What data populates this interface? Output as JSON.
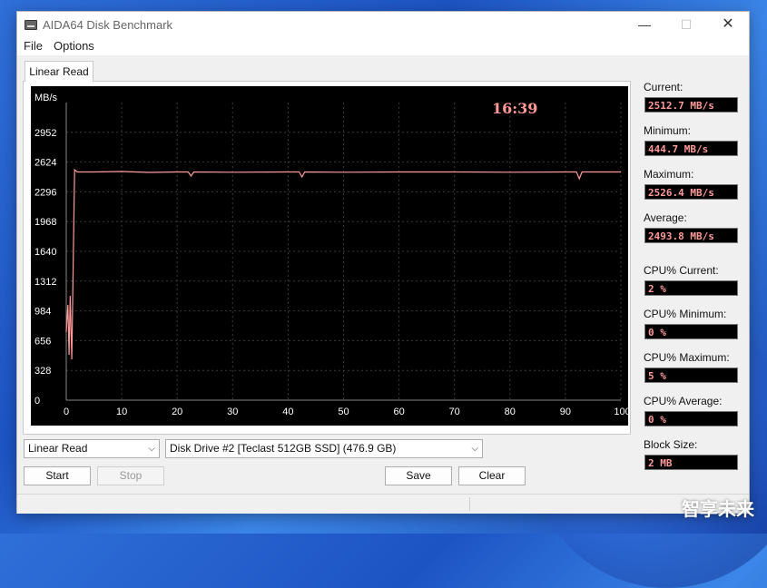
{
  "window": {
    "title": "AIDA64 Disk Benchmark",
    "controls": {
      "minimize": "—",
      "maximize": "☐",
      "close": "✕"
    }
  },
  "menu": {
    "file": "File",
    "options": "Options"
  },
  "tab": {
    "label": "Linear Read"
  },
  "chart_data": {
    "type": "line",
    "ylabel": "MB/s",
    "time": "16:39",
    "y_ticks": [
      "2952",
      "2624",
      "2296",
      "1968",
      "1640",
      "1312",
      "984",
      "656",
      "328",
      "0"
    ],
    "x_ticks": [
      "0",
      "10",
      "20",
      "30",
      "40",
      "50",
      "60",
      "70",
      "80",
      "90",
      "100 %"
    ],
    "xlim": [
      0,
      100
    ],
    "ylim": [
      0,
      3280
    ],
    "grid": true,
    "line_color": "#ff9a9a",
    "background": "#000000",
    "series": [
      {
        "x": [
          0,
          0.3,
          0.5,
          0.7,
          1,
          1.5,
          2,
          5,
          10,
          15,
          20,
          22,
          22.5,
          23,
          30,
          40,
          42,
          42.5,
          43,
          50,
          60,
          70,
          80,
          90,
          92,
          92.5,
          93,
          95,
          100
        ],
        "y": [
          750,
          1050,
          500,
          1150,
          450,
          2540,
          2515,
          2515,
          2520,
          2510,
          2515,
          2515,
          2470,
          2515,
          2512,
          2515,
          2515,
          2460,
          2515,
          2512,
          2515,
          2515,
          2512,
          2515,
          2515,
          2440,
          2515,
          2515,
          2515
        ]
      }
    ]
  },
  "stats": {
    "current": {
      "label": "Current:",
      "value": "2512.7 MB/s"
    },
    "minimum": {
      "label": "Minimum:",
      "value": "444.7 MB/s"
    },
    "maximum": {
      "label": "Maximum:",
      "value": "2526.4 MB/s"
    },
    "average": {
      "label": "Average:",
      "value": "2493.8 MB/s"
    },
    "cpu_current": {
      "label": "CPU% Current:",
      "value": "2 %"
    },
    "cpu_minimum": {
      "label": "CPU% Minimum:",
      "value": "0 %"
    },
    "cpu_maximum": {
      "label": "CPU% Maximum:",
      "value": "5 %"
    },
    "cpu_average": {
      "label": "CPU% Average:",
      "value": "0 %"
    },
    "block_size": {
      "label": "Block Size:",
      "value": "2 MB"
    }
  },
  "controls": {
    "test_select": "Linear Read",
    "drive_select": "Disk Drive #2  [Teclast 512GB SSD]  (476.9 GB)",
    "start": "Start",
    "stop": "Stop",
    "save": "Save",
    "clear": "Clear"
  },
  "watermark": "智享未来"
}
